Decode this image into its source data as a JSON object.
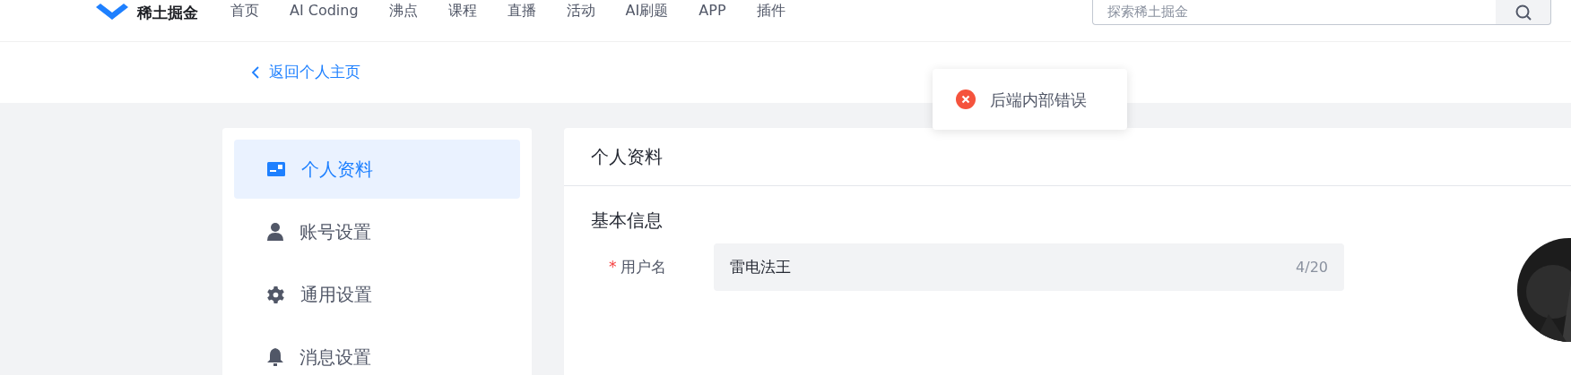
{
  "header": {
    "logo": "稀土掘金",
    "nav": [
      {
        "label": "首页",
        "selected": false
      },
      {
        "label": "AI Coding",
        "selected": false
      },
      {
        "label": "沸点",
        "selected": false
      },
      {
        "label": "课程",
        "selected": false
      },
      {
        "label": "直播",
        "selected": false
      },
      {
        "label": "活动",
        "selected": false
      },
      {
        "label": "AI刷题",
        "selected": false
      },
      {
        "label": "APP",
        "selected": false
      },
      {
        "label": "插件",
        "selected": false
      }
    ],
    "search": {
      "placeholder": "探索稀土掘金"
    }
  },
  "back_link": "返回个人主页",
  "toast": {
    "kind": "error",
    "message": "后端内部错误"
  },
  "sidebar": {
    "items": [
      {
        "label": "个人资料",
        "kind": "card",
        "selected": true
      },
      {
        "label": "账号设置",
        "kind": "person",
        "selected": false
      },
      {
        "label": "通用设置",
        "kind": "gear",
        "selected": false
      },
      {
        "label": "消息设置",
        "kind": "bell",
        "selected": false
      }
    ]
  },
  "main": {
    "title": "个人资料",
    "section": "基本信息",
    "fields": [
      {
        "label": "用户名",
        "required_mark": "*",
        "value": "雷电法王",
        "counter": "4/20"
      }
    ]
  }
}
